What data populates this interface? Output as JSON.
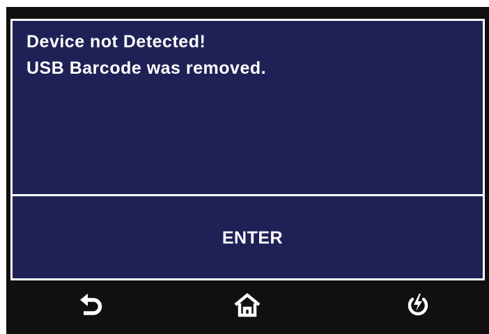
{
  "dialog": {
    "lines": [
      "Device not Detected!",
      "USB Barcode was removed."
    ]
  },
  "enter_button": {
    "label": "ENTER"
  },
  "nav": {
    "icons": [
      "back-arrow-icon",
      "home-icon",
      "power-icon"
    ]
  },
  "colors": {
    "panel_bg": "#1f2156",
    "frame_bg": "#101010",
    "text": "#ffffff"
  }
}
